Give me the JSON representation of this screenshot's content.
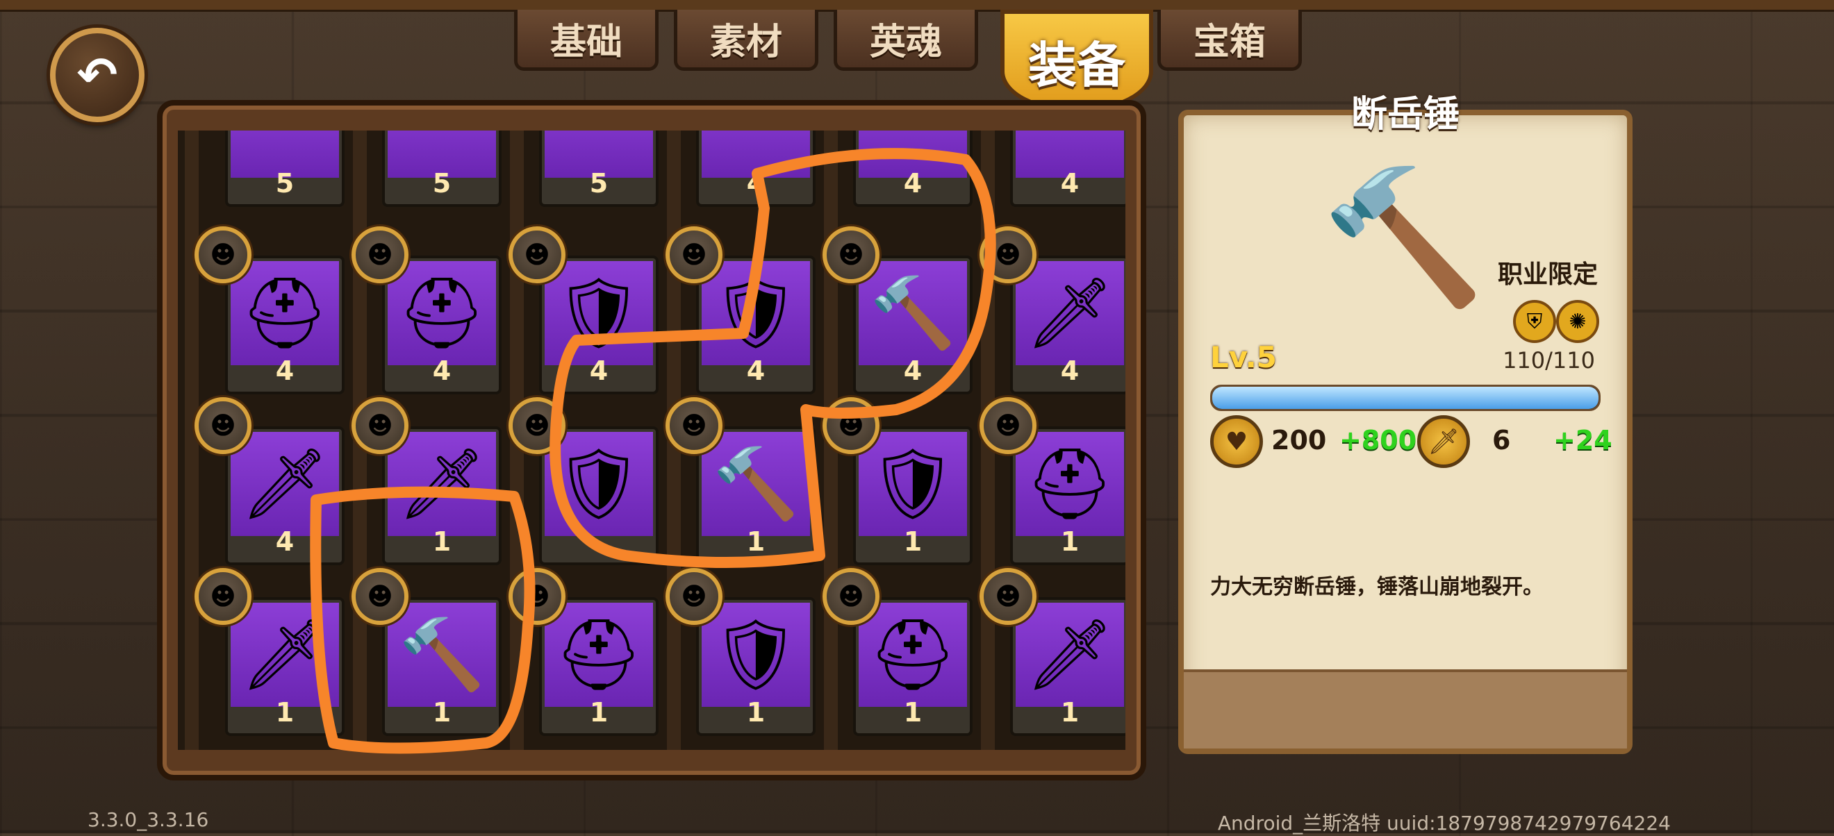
{
  "tabs": [
    {
      "label": "基础",
      "active": false
    },
    {
      "label": "素材",
      "active": false
    },
    {
      "label": "英魂",
      "active": false
    },
    {
      "label": "装备",
      "active": true
    },
    {
      "label": "宝箱",
      "active": false
    }
  ],
  "back_button": {
    "icon": "back-arrow-icon",
    "glyph": "↶"
  },
  "equipment": {
    "rows": [
      [
        {
          "icon": "equipment-icon",
          "glyph": "",
          "count": "5"
        },
        {
          "icon": "equipment-icon",
          "glyph": "",
          "count": "5"
        },
        {
          "icon": "equipment-icon",
          "glyph": "",
          "count": "5"
        },
        {
          "icon": "equipment-icon",
          "glyph": "",
          "count": "4"
        },
        {
          "icon": "equipment-icon",
          "glyph": "",
          "count": "4"
        },
        {
          "icon": "equipment-icon",
          "glyph": "",
          "count": "4"
        }
      ],
      [
        {
          "icon": "helmet-icon",
          "glyph": "⛑",
          "count": "4",
          "class_icon": "knight-badge-icon"
        },
        {
          "icon": "helmet-icon",
          "glyph": "⛑",
          "count": "4",
          "class_icon": "knight-badge-icon"
        },
        {
          "icon": "armor-icon",
          "glyph": "🛡",
          "count": "4",
          "class_icon": "knight-badge-icon"
        },
        {
          "icon": "armor-icon",
          "glyph": "🛡",
          "count": "4",
          "class_icon": "knight-badge-icon"
        },
        {
          "icon": "hammer-icon",
          "glyph": "🔨",
          "count": "4",
          "class_icon": "dwarf-badge-icon"
        },
        {
          "icon": "sword-icon",
          "glyph": "🗡",
          "count": "4",
          "class_icon": "knight-badge-icon"
        }
      ],
      [
        {
          "icon": "sword-icon",
          "glyph": "🗡",
          "count": "4",
          "class_icon": "knight-badge-icon"
        },
        {
          "icon": "sword-icon",
          "glyph": "🗡",
          "count": "1",
          "class_icon": "rider-badge-icon"
        },
        {
          "icon": "armor-icon",
          "glyph": "🛡",
          "count": "",
          "class_icon": "knight-badge-icon"
        },
        {
          "icon": "hammer-icon",
          "glyph": "🔨",
          "count": "1",
          "class_icon": "dwarf-badge-icon"
        },
        {
          "icon": "armor-icon",
          "glyph": "🛡",
          "count": "1",
          "class_icon": "archer-badge-icon"
        },
        {
          "icon": "helmet-icon",
          "glyph": "⛑",
          "count": "1",
          "class_icon": "knight-badge-icon"
        }
      ],
      [
        {
          "icon": "sword-icon",
          "glyph": "🗡",
          "count": "1",
          "class_icon": "rider-badge-icon"
        },
        {
          "icon": "hammer-icon",
          "glyph": "🔨",
          "count": "1",
          "class_icon": "dwarf-badge-icon"
        },
        {
          "icon": "helmet-icon",
          "glyph": "⛑",
          "count": "1",
          "class_icon": "knight-badge-icon"
        },
        {
          "icon": "armor-icon",
          "glyph": "🛡",
          "count": "1",
          "class_icon": "dwarf-badge-icon"
        },
        {
          "icon": "helmet-icon",
          "glyph": "⛑",
          "count": "1",
          "class_icon": "dwarf-badge-icon"
        },
        {
          "icon": "sword-icon",
          "glyph": "🗡",
          "count": "1",
          "class_icon": "knight-badge-icon"
        }
      ]
    ],
    "badge_glyph": "☻"
  },
  "detail": {
    "title": "断岳锤",
    "icon": "hammer-icon",
    "glyph": "🔨",
    "restriction": "职业限定",
    "class_icons": [
      {
        "name": "shield-class-icon",
        "glyph": "⛨"
      },
      {
        "name": "swirl-class-icon",
        "glyph": "✺"
      }
    ],
    "level": "Lv.5",
    "exp": "110/110",
    "exp_fraction": 1.0,
    "hp": {
      "icon": "heart-icon",
      "glyph": "♥",
      "value": "200",
      "bonus": "+800"
    },
    "attack": {
      "icon": "sword-stat-icon",
      "glyph": "🗡",
      "value": "6",
      "bonus": "+24"
    },
    "description": "力大无穷断岳锤，锤落山崩地裂开。"
  },
  "footer": {
    "version": "3.3.0_3.3.16",
    "device": "Android_兰斯洛特 uuid:1879798742979764224"
  },
  "colors": {
    "bonus_green": "#2fd21e",
    "card_purple": "#7a33c4",
    "annotation_orange": "#f7852a"
  }
}
